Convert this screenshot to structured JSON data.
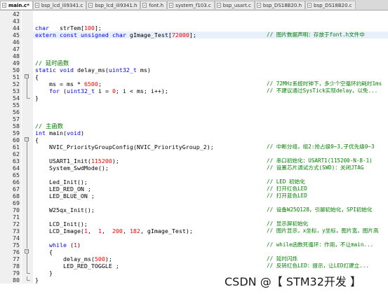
{
  "tabs": [
    {
      "label": "main.c*",
      "active": true
    },
    {
      "label": "bsp_lcd_ili9341.c",
      "active": false
    },
    {
      "label": "bsp_lcd_ili9341.h",
      "active": false
    },
    {
      "label": "font.h",
      "active": false
    },
    {
      "label": "system_f103.c",
      "active": false
    },
    {
      "label": "bsp_usart.c",
      "active": false
    },
    {
      "label": "bsp_DS18B20.h",
      "active": false
    },
    {
      "label": "bsp_DS18B20.c",
      "active": false
    }
  ],
  "lines": [
    {
      "num": "42",
      "fold": "",
      "code": "",
      "comment": ""
    },
    {
      "num": "43",
      "fold": "",
      "code": "",
      "comment": ""
    },
    {
      "num": "44",
      "fold": "",
      "code": "char   strTem[100];",
      "comment": ""
    },
    {
      "num": "45",
      "fold": "",
      "code": "extern const unsigned char gImage_Test[72000];",
      "comment": "// 图片数据声明：存放于font.h文件中",
      "highlight": true
    },
    {
      "num": "46",
      "fold": "",
      "code": "",
      "comment": ""
    },
    {
      "num": "47",
      "fold": "",
      "code": "",
      "comment": ""
    },
    {
      "num": "48",
      "fold": "",
      "code": "",
      "comment": ""
    },
    {
      "num": "49",
      "fold": "",
      "code": "// 延时函数",
      "comment": "",
      "code_is_comment": true
    },
    {
      "num": "50",
      "fold": "",
      "code": "static void delay_ms(uint32_t ms)",
      "comment": ""
    },
    {
      "num": "51",
      "fold": "open",
      "code": "{",
      "comment": ""
    },
    {
      "num": "52",
      "fold": "line",
      "code": "    ms = ms * 6500;",
      "comment": "// 72MHz系统时钟下，多少个空循环约耗时1ms"
    },
    {
      "num": "53",
      "fold": "line",
      "code": "    for (uint32_t i = 0; i < ms; i++);",
      "comment": "// 不建议通过SysTick实现delay，以免..."
    },
    {
      "num": "54",
      "fold": "end",
      "code": "}",
      "comment": ""
    },
    {
      "num": "55",
      "fold": "",
      "code": "",
      "comment": ""
    },
    {
      "num": "56",
      "fold": "",
      "code": "",
      "comment": ""
    },
    {
      "num": "57",
      "fold": "",
      "code": "",
      "comment": ""
    },
    {
      "num": "58",
      "fold": "",
      "code": "// 主函数",
      "comment": "",
      "code_is_comment": true
    },
    {
      "num": "59",
      "fold": "",
      "code": "int main(void)",
      "comment": ""
    },
    {
      "num": "60",
      "fold": "open",
      "code": "{",
      "comment": ""
    },
    {
      "num": "61",
      "fold": "line",
      "code": "    NVIC_PriorityGroupConfig(NVIC_PriorityGroup_2);",
      "comment": "// 中断分组，组2:抢占级0~3,子优先级0~3"
    },
    {
      "num": "62",
      "fold": "line",
      "code": "",
      "comment": ""
    },
    {
      "num": "63",
      "fold": "line",
      "code": "    USART1_Init(115200);",
      "comment": "// 串口初始化：USART1(115200-N-8-1)"
    },
    {
      "num": "64",
      "fold": "line",
      "code": "    System_SwdMode();",
      "comment": "// 设置芯片调试方式(SWD)：关闭JTAG"
    },
    {
      "num": "65",
      "fold": "line",
      "code": "",
      "comment": ""
    },
    {
      "num": "66",
      "fold": "line",
      "code": "    Led_Init();",
      "comment": "// LED 初始化"
    },
    {
      "num": "67",
      "fold": "line",
      "code": "    LED_RED_ON ;",
      "comment": "// 打开红色LED"
    },
    {
      "num": "68",
      "fold": "line",
      "code": "    LED_BLUE_ON ;",
      "comment": "// 打开蓝色LED"
    },
    {
      "num": "69",
      "fold": "line",
      "code": "",
      "comment": ""
    },
    {
      "num": "70",
      "fold": "line",
      "code": "    W25qx_Init();",
      "comment": "// 设备W25Q128，引脚初始化，SPI初始化"
    },
    {
      "num": "71",
      "fold": "line",
      "code": "",
      "comment": ""
    },
    {
      "num": "72",
      "fold": "line",
      "code": "    LCD_Init();",
      "comment": "// 显示屏初始化"
    },
    {
      "num": "73",
      "fold": "line",
      "code": "    LCD_Image(1,  1,  200, 182, gImage_Test);",
      "comment": "// 图片显示，x坐标，y坐标，图片宽，图片高"
    },
    {
      "num": "74",
      "fold": "line",
      "code": "",
      "comment": ""
    },
    {
      "num": "75",
      "fold": "line",
      "code": "    while (1)",
      "comment": "// while函数死循环：作用，不让main..."
    },
    {
      "num": "76",
      "fold": "open",
      "code": "    {",
      "comment": ""
    },
    {
      "num": "77",
      "fold": "line",
      "code": "        delay_ms(500);",
      "comment": "// 延时闪烁"
    },
    {
      "num": "78",
      "fold": "line",
      "code": "        LED_RED_TOGGLE ;",
      "comment": "// 反转红色LED：提示，让LED灯建立..."
    },
    {
      "num": "79",
      "fold": "end",
      "code": "    }",
      "comment": ""
    },
    {
      "num": "80",
      "fold": "end",
      "code": "}",
      "comment": ""
    }
  ],
  "watermark": "CSDN @【 STM32开发 】"
}
